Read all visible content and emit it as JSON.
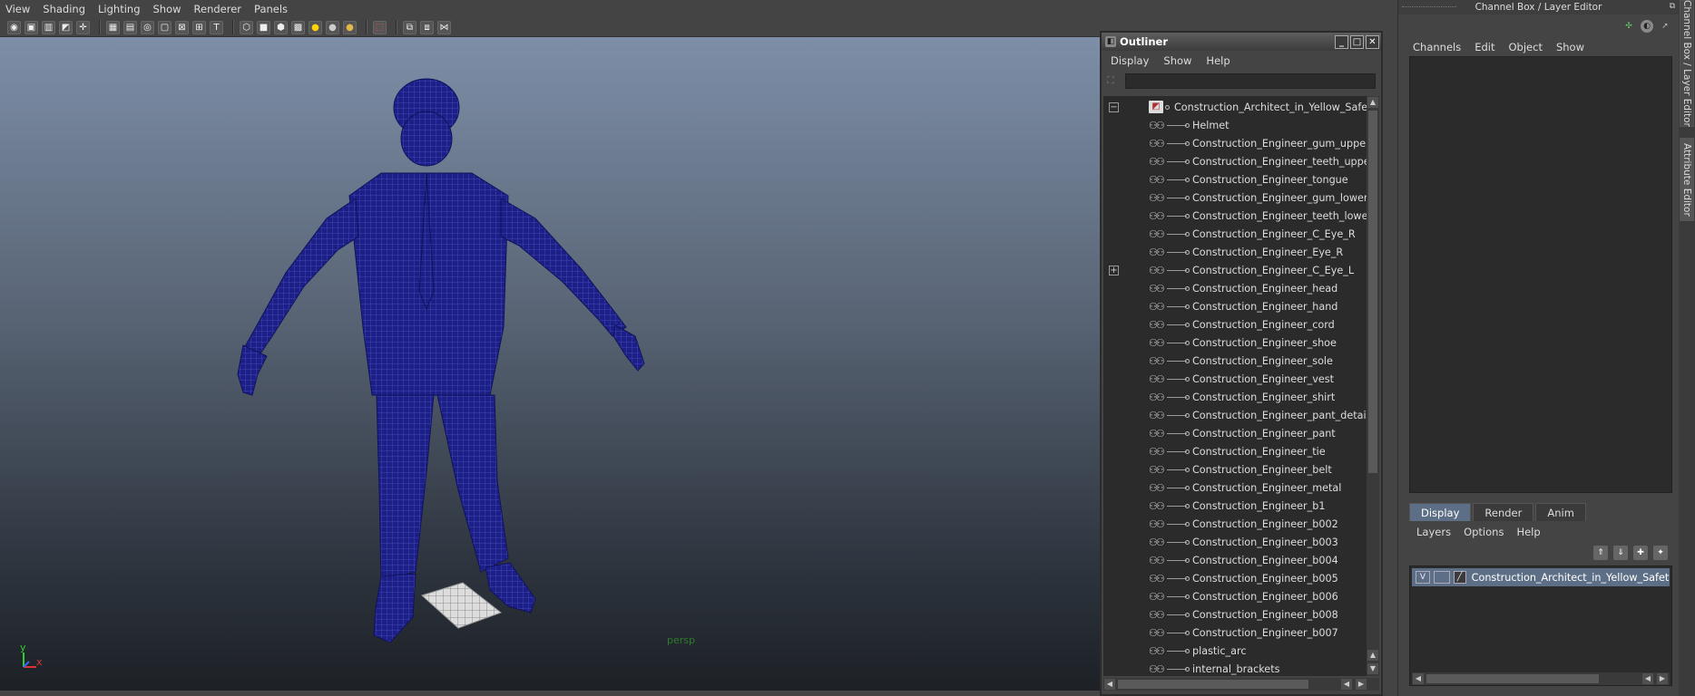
{
  "viewport": {
    "menus": [
      "View",
      "Shading",
      "Lighting",
      "Show",
      "Renderer",
      "Panels"
    ],
    "toolbar_icons": [
      "camera-icon",
      "camera-attr-icon",
      "bookmark-icon",
      "image-plane-icon",
      "grid-icon",
      "film-gate-icon",
      "resolution-gate-icon",
      "safe-area-icon",
      "field-chart-icon",
      "safe-action-icon",
      "safe-title-icon",
      "wireframe-icon",
      "smooth-shade-icon",
      "wireframe-on-shaded-icon",
      "xray-icon",
      "default-light-icon",
      "all-lights-icon",
      "shadows-icon",
      "isolate-select-icon",
      "xray-joints-icon",
      "xray-active-icon"
    ],
    "camera_label": "persp",
    "axis": {
      "y": "y",
      "x": "x"
    },
    "wire_color": "#1a1f7a"
  },
  "outliner": {
    "title": "Outliner",
    "menus": [
      "Display",
      "Show",
      "Help"
    ],
    "search_value": "",
    "root": "Construction_Architect_in_Yellow_Safety_Ja",
    "items": [
      "Helmet",
      "Construction_Engineer_gum_upper",
      "Construction_Engineer_teeth_upper",
      "Construction_Engineer_tongue",
      "Construction_Engineer_gum_lower",
      "Construction_Engineer_teeth_lower",
      "Construction_Engineer_C_Eye_R",
      "Construction_Engineer_Eye_R",
      "Construction_Engineer_C_Eye_L",
      "Construction_Engineer_head",
      "Construction_Engineer_hand",
      "Construction_Engineer_cord",
      "Construction_Engineer_shoe",
      "Construction_Engineer_sole",
      "Construction_Engineer_vest",
      "Construction_Engineer_shirt",
      "Construction_Engineer_pant_detail",
      "Construction_Engineer_pant",
      "Construction_Engineer_tie",
      "Construction_Engineer_belt",
      "Construction_Engineer_metal",
      "Construction_Engineer_b1",
      "Construction_Engineer_b002",
      "Construction_Engineer_b003",
      "Construction_Engineer_b004",
      "Construction_Engineer_b005",
      "Construction_Engineer_b006",
      "Construction_Engineer_b008",
      "Construction_Engineer_b007",
      "plastic_arc",
      "internal_brackets"
    ]
  },
  "channel_box": {
    "title": "Channel Box / Layer Editor",
    "menus": [
      "Channels",
      "Edit",
      "Object",
      "Show"
    ],
    "layer_tabs": [
      "Display",
      "Render",
      "Anim"
    ],
    "layer_menus": [
      "Layers",
      "Options",
      "Help"
    ],
    "layer": {
      "visible": "V",
      "name": "Construction_Architect_in_Yellow_Safety_Jac"
    }
  },
  "side_tabs": [
    "Channel Box / Layer Editor",
    "Attribute Editor"
  ],
  "colors": {
    "selection": "#5d6f86",
    "panel": "#444444",
    "list_bg": "#2b2b2b"
  }
}
